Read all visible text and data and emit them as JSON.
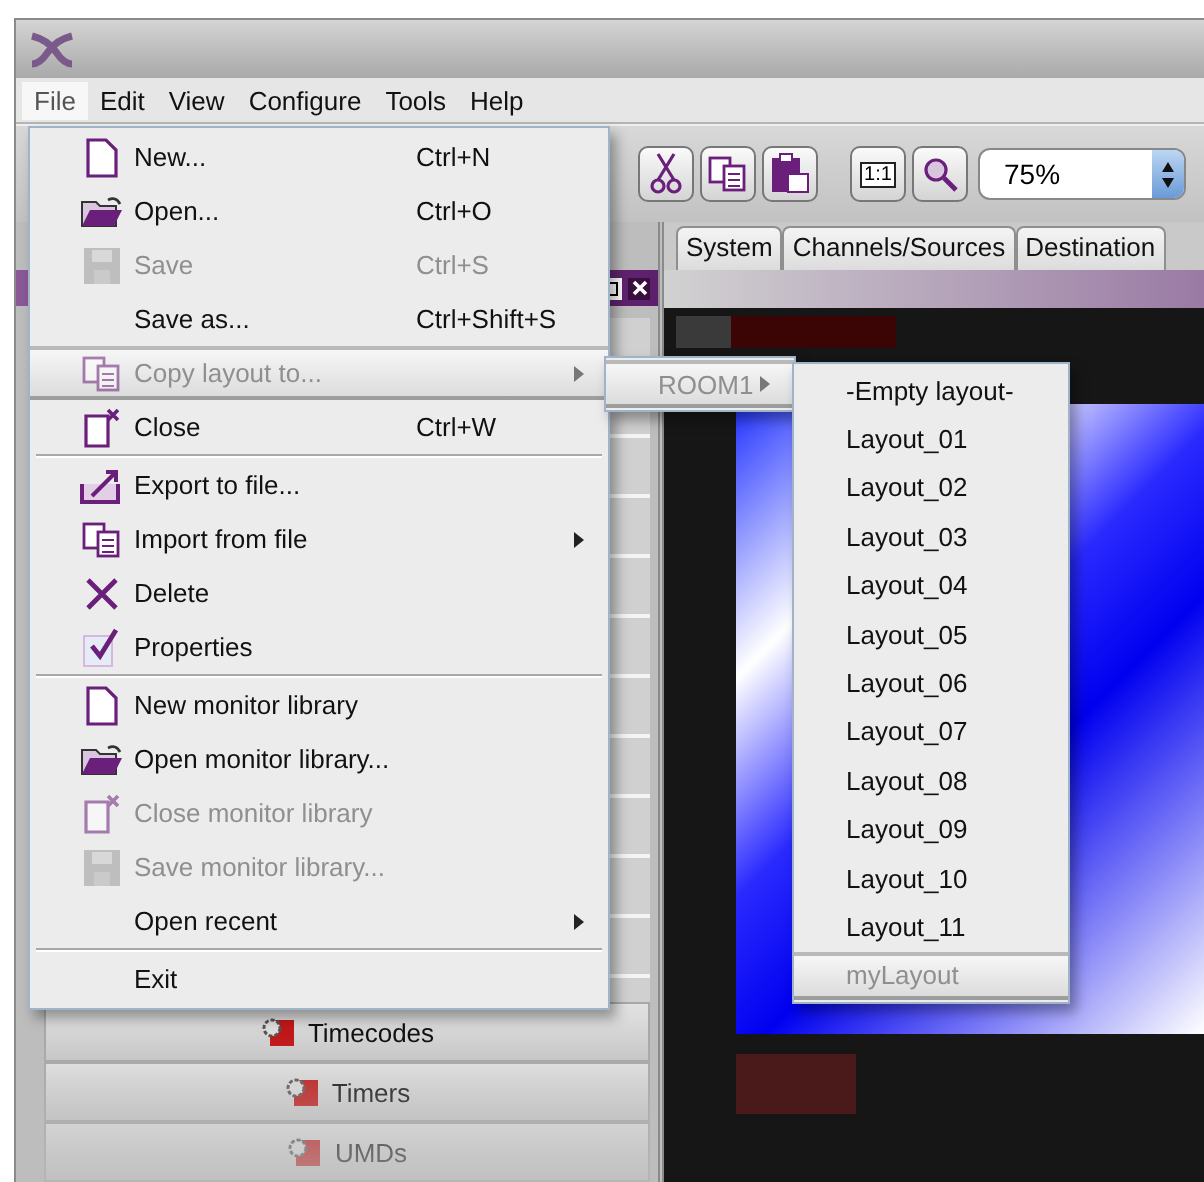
{
  "menubar": [
    {
      "label": "File",
      "selected": true
    },
    {
      "label": "Edit",
      "selected": false
    },
    {
      "label": "View",
      "selected": false
    },
    {
      "label": "Configure",
      "selected": false
    },
    {
      "label": "Tools",
      "selected": false
    },
    {
      "label": "Help",
      "selected": false
    }
  ],
  "toolbar": {
    "buttons": [
      {
        "kind": "cut"
      },
      {
        "kind": "copy"
      },
      {
        "kind": "paste"
      },
      {
        "kind": "gap"
      },
      {
        "kind": "actual-size",
        "label": "1:1"
      },
      {
        "kind": "zoom"
      }
    ],
    "zoom_field": {
      "value": "75%"
    }
  },
  "tabs": [
    {
      "label": "System",
      "selected": false
    },
    {
      "label": "Channels/Sources",
      "selected": false
    },
    {
      "label": "Destination",
      "selected": false
    }
  ],
  "sidebar": {
    "items": [
      {
        "label": "Timecodes"
      },
      {
        "label": "Timers"
      },
      {
        "label": "UMDs"
      }
    ]
  },
  "file_menu": [
    {
      "kind": "page",
      "label": "New...",
      "shortcut": "Ctrl+N",
      "disabled": false,
      "selected": false,
      "submenu": false
    },
    {
      "kind": "folder",
      "label": "Open...",
      "shortcut": "Ctrl+O",
      "disabled": false,
      "selected": false,
      "submenu": false
    },
    {
      "kind": "disk",
      "label": "Save",
      "shortcut": "Ctrl+S",
      "disabled": true,
      "selected": false,
      "submenu": false
    },
    {
      "kind": "plain",
      "label": "Save as...",
      "shortcut": "Ctrl+Shift+S",
      "disabled": false,
      "selected": false,
      "submenu": false
    },
    {
      "kind": "copy",
      "label": "Copy layout to...",
      "disabled": true,
      "selected": true,
      "submenu": true
    },
    {
      "kind": "close-page",
      "label": "Close",
      "shortcut": "Ctrl+W",
      "disabled": false,
      "selected": false,
      "submenu": false
    },
    {
      "kind": "separator"
    },
    {
      "kind": "export",
      "label": "Export to file...",
      "disabled": false,
      "selected": false,
      "submenu": false
    },
    {
      "kind": "copy",
      "label": "Import from file",
      "disabled": false,
      "selected": false,
      "submenu": true
    },
    {
      "kind": "cross",
      "label": "Delete",
      "disabled": false,
      "selected": false,
      "submenu": false
    },
    {
      "kind": "check",
      "label": "Properties",
      "disabled": false,
      "selected": false,
      "submenu": false
    },
    {
      "kind": "separator"
    },
    {
      "kind": "page",
      "label": "New monitor library",
      "disabled": false,
      "selected": false,
      "submenu": false
    },
    {
      "kind": "folder",
      "label": "Open monitor library...",
      "disabled": false,
      "selected": false,
      "submenu": false
    },
    {
      "kind": "close-page",
      "label": "Close monitor library",
      "disabled": true,
      "selected": false,
      "submenu": false
    },
    {
      "kind": "disk",
      "label": "Save monitor library...",
      "disabled": true,
      "selected": false,
      "submenu": false
    },
    {
      "kind": "plain",
      "label": "Open recent",
      "disabled": false,
      "selected": false,
      "submenu": true
    },
    {
      "kind": "separator"
    },
    {
      "kind": "plain",
      "label": "Exit",
      "disabled": false,
      "selected": false,
      "submenu": false
    }
  ],
  "room_menu": [
    {
      "kind": "item",
      "label": "ROOM1",
      "disabled": true,
      "selected": true,
      "submenu": true
    }
  ],
  "layout_menu": [
    {
      "kind": "item",
      "label": "-Empty layout-",
      "disabled": false,
      "selected": false
    },
    {
      "kind": "item",
      "label": "Layout_01",
      "disabled": false,
      "selected": false
    },
    {
      "kind": "item",
      "label": "Layout_02",
      "disabled": false,
      "selected": false
    },
    {
      "kind": "item",
      "label": "Layout_03",
      "disabled": false,
      "selected": false
    },
    {
      "kind": "item",
      "label": "Layout_04",
      "disabled": false,
      "selected": false
    },
    {
      "kind": "item",
      "label": "Layout_05",
      "disabled": false,
      "selected": false
    },
    {
      "kind": "item",
      "label": "Layout_06",
      "disabled": false,
      "selected": false
    },
    {
      "kind": "item",
      "label": "Layout_07",
      "disabled": false,
      "selected": false
    },
    {
      "kind": "item",
      "label": "Layout_08",
      "disabled": false,
      "selected": false
    },
    {
      "kind": "item",
      "label": "Layout_09",
      "disabled": false,
      "selected": false
    },
    {
      "kind": "item",
      "label": "Layout_10",
      "disabled": false,
      "selected": false
    },
    {
      "kind": "item",
      "label": "Layout_11",
      "disabled": false,
      "selected": false
    },
    {
      "kind": "item",
      "label": "myLayout",
      "disabled": true,
      "selected": true
    }
  ]
}
